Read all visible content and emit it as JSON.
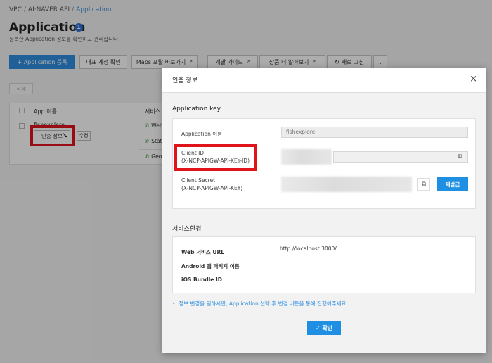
{
  "breadcrumb": {
    "items": [
      "VPC",
      "AI·NAVER API"
    ],
    "current": "Application",
    "sep": "/"
  },
  "page": {
    "title": "Application",
    "badge": "1",
    "subtitle": "등록한 Application 정보를 확인하고 관리합니다."
  },
  "toolbar": {
    "register": "+ Application 등록",
    "rep_account": "대표 계정 확인",
    "maps": "Maps 포탈 바로가기",
    "dev_guide": "개발 가이드",
    "product_more": "상품 더 알아보기",
    "refresh": "새로 고침",
    "ext_icon": "↗",
    "refresh_icon": "↻",
    "more_icon": "⌄"
  },
  "list": {
    "delete_label": "삭제",
    "headers": [
      "App 이름",
      "서비스"
    ],
    "app_name": "fishexplore",
    "auth_label": "인증 정보",
    "edit_label": "수정",
    "services": [
      "Web",
      "Stat",
      "Geo"
    ]
  },
  "modal": {
    "title": "인증 정보",
    "close_icon": "×",
    "section_app_key": "Application key",
    "app_name_label": "Application 이름",
    "app_name_value": "fishexplore",
    "client_id_label": "Client ID",
    "client_id_sub": "(X-NCP-APIGW-API-KEY-ID)",
    "client_secret_label": "Client Secret",
    "client_secret_sub": "(X-NCP-APIGW-API-KEY)",
    "reissue_label": "재발급",
    "copy_icon": "⧉",
    "section_service": "서비스환경",
    "web_url_label": "Web 서비스 URL",
    "web_url_value": "http://localhost:3000/",
    "android_label": "Android 앱 패키지 이름",
    "ios_label": "iOS Bundle ID",
    "notice": "정보 변경을 원하시면, Application 선택 후 변경 버튼을 통해 진행해주세요.",
    "confirm_label": "✓ 확인"
  },
  "colors": {
    "accent": "#1e8fe3",
    "highlight": "#e0131c"
  }
}
